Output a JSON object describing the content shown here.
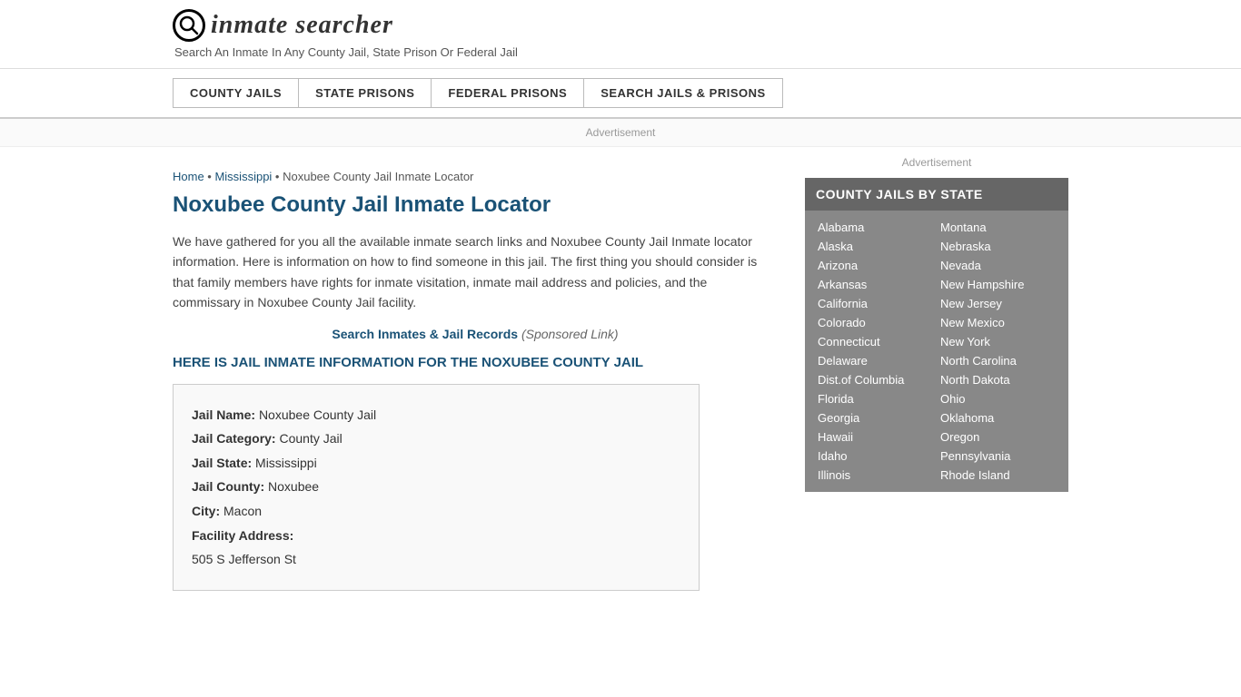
{
  "header": {
    "logo_icon": "🔍",
    "logo_text": "inmate searcher",
    "tagline": "Search An Inmate In Any County Jail, State Prison Or Federal Jail"
  },
  "nav": {
    "items": [
      {
        "label": "COUNTY JAILS",
        "href": "#"
      },
      {
        "label": "STATE PRISONS",
        "href": "#"
      },
      {
        "label": "FEDERAL PRISONS",
        "href": "#"
      },
      {
        "label": "SEARCH JAILS & PRISONS",
        "href": "#"
      }
    ]
  },
  "ad_bar": "Advertisement",
  "breadcrumb": {
    "home": "Home",
    "state": "Mississippi",
    "current": "Noxubee County Jail Inmate Locator"
  },
  "page": {
    "title": "Noxubee County Jail Inmate Locator",
    "description": "We have gathered for you all the available inmate search links and Noxubee County Jail Inmate locator information. Here is information on how to find someone in this jail. The first thing you should consider is that family members have rights for inmate visitation, inmate mail address and policies, and the commissary in Noxubee County Jail facility.",
    "search_link_text": "Search Inmates & Jail Records",
    "sponsored_text": "(Sponsored Link)",
    "section_heading": "HERE IS JAIL INMATE INFORMATION FOR THE NOXUBEE COUNTY JAIL"
  },
  "jail_info": {
    "name_label": "Jail Name:",
    "name_value": "Noxubee County Jail",
    "category_label": "Jail Category:",
    "category_value": "County Jail",
    "state_label": "Jail State:",
    "state_value": "Mississippi",
    "county_label": "Jail County:",
    "county_value": "Noxubee",
    "city_label": "City:",
    "city_value": "Macon",
    "address_label": "Facility Address:",
    "address_value": "505 S Jefferson St"
  },
  "sidebar": {
    "ad_text": "Advertisement",
    "county_jails_title": "COUNTY JAILS BY STATE",
    "states_col1": [
      "Alabama",
      "Alaska",
      "Arizona",
      "Arkansas",
      "California",
      "Colorado",
      "Connecticut",
      "Delaware",
      "Dist.of Columbia",
      "Florida",
      "Georgia",
      "Hawaii",
      "Idaho",
      "Illinois"
    ],
    "states_col2": [
      "Montana",
      "Nebraska",
      "Nevada",
      "New Hampshire",
      "New Jersey",
      "New Mexico",
      "New York",
      "North Carolina",
      "North Dakota",
      "Ohio",
      "Oklahoma",
      "Oregon",
      "Pennsylvania",
      "Rhode Island"
    ]
  }
}
